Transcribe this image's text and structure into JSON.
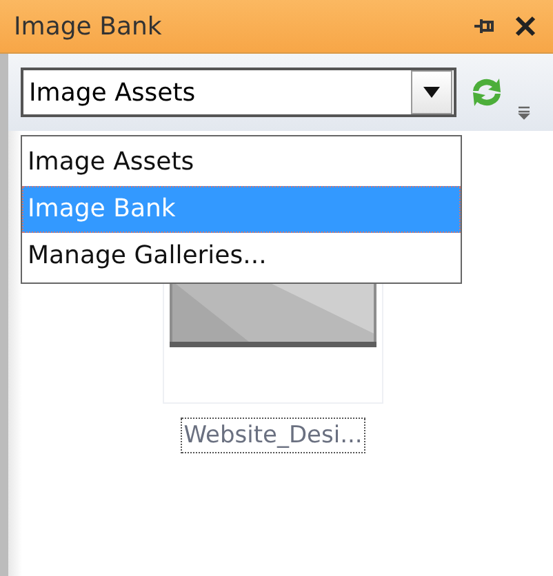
{
  "panel": {
    "title": "Image Bank"
  },
  "combo": {
    "value": "Image Assets"
  },
  "dropdown": {
    "items": [
      {
        "label": "Image Assets",
        "selected": false
      },
      {
        "label": "Image Bank",
        "selected": true
      },
      {
        "label": "Manage Galleries...",
        "selected": false
      }
    ]
  },
  "thumbnails": [
    {
      "kind": "picture",
      "caption": "Website_Desi..."
    }
  ]
}
